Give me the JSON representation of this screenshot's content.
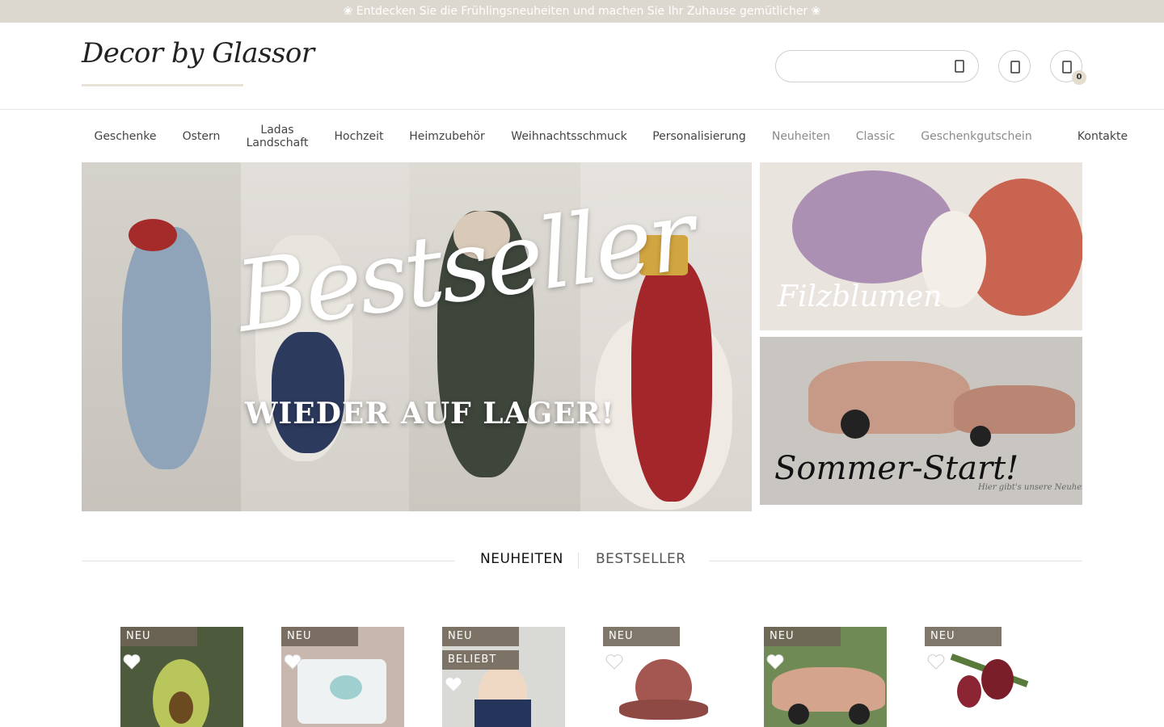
{
  "announcement": "❀ Entdecken Sie die Frühlingsneuheiten und machen Sie Ihr Zuhause gemütlicher ❀",
  "logo": {
    "text": "Decor by Glassor"
  },
  "search": {
    "value": "",
    "placeholder": ""
  },
  "cart": {
    "count": "0"
  },
  "nav": [
    {
      "label": "Geschenke"
    },
    {
      "label": "Ostern"
    },
    {
      "label": "Ladas Landschaft"
    },
    {
      "label": "Hochzeit"
    },
    {
      "label": "Heimzubehör"
    },
    {
      "label": "Weihnachtsschmuck"
    },
    {
      "label": "Personalisierung"
    },
    {
      "label": "Neuheiten"
    },
    {
      "label": "Classic"
    },
    {
      "label": "Geschenkgutschein"
    },
    {
      "label": "Kontakte"
    }
  ],
  "hero": {
    "title": "Bestseller",
    "subtitle": "WIEDER AUF LAGER!"
  },
  "side_banners": [
    {
      "label": "Filzblumen"
    },
    {
      "label": "Sommer-Start!",
      "caption": "Hier gibt's unsere Neuheiten"
    }
  ],
  "tabs": {
    "active": "NEUHEITEN",
    "inactive": "BESTSELLER"
  },
  "products": [
    {
      "badges": [
        "NEU"
      ]
    },
    {
      "badges": [
        "NEU"
      ]
    },
    {
      "badges": [
        "NEU",
        "BELIEBT"
      ]
    },
    {
      "badges": [
        "NEU"
      ]
    },
    {
      "badges": [
        "NEU"
      ]
    },
    {
      "badges": [
        "NEU"
      ]
    }
  ],
  "colors": {
    "topbar": "#dcd8cf",
    "badge": "#6e6456",
    "accent_text": "#222222"
  }
}
